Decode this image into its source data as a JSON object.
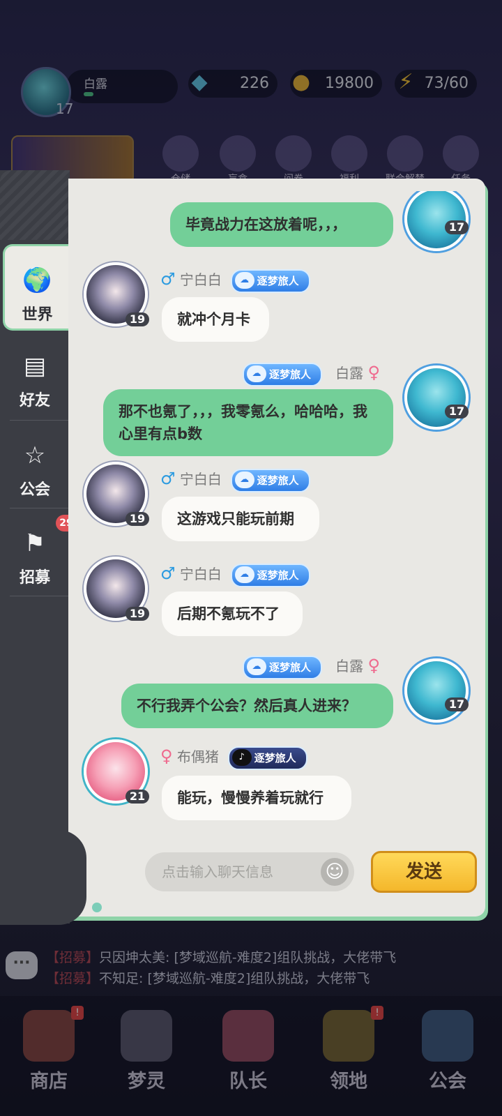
{
  "hud": {
    "player_name": "白露",
    "player_level": "17",
    "gems": "226",
    "coins": "19800",
    "energy": "73/60",
    "menu": [
      "仓储",
      "盲盒",
      "问卷",
      "福利",
      "联合解禁",
      "任务"
    ]
  },
  "tabs": [
    {
      "label": "世界",
      "icon": "globe-icon"
    },
    {
      "label": "好友",
      "icon": "notebook-icon"
    },
    {
      "label": "公会",
      "icon": "guild-shield-icon"
    },
    {
      "label": "招募",
      "icon": "flag-icon",
      "badge": "29"
    }
  ],
  "messages": [
    {
      "side": "out",
      "name": "",
      "title": "",
      "level": "17",
      "text": "毕竟战力在这放着呢，，，"
    },
    {
      "side": "in",
      "name": "宁白白",
      "gender": "♂",
      "title": "逐梦旅人",
      "level": "19",
      "text": "就冲个月卡"
    },
    {
      "side": "out",
      "name": "白露",
      "gender": "♀",
      "title": "逐梦旅人",
      "level": "17",
      "text": "那不也氪了，，，我零氪么，哈哈哈，我心里有点b数"
    },
    {
      "side": "in",
      "name": "宁白白",
      "gender": "♂",
      "title": "逐梦旅人",
      "level": "19",
      "text": "这游戏只能玩前期"
    },
    {
      "side": "in",
      "name": "宁白白",
      "gender": "♂",
      "title": "逐梦旅人",
      "level": "19",
      "text": "后期不氪玩不了"
    },
    {
      "side": "out",
      "name": "白露",
      "gender": "♀",
      "title": "逐梦旅人",
      "level": "17",
      "text": "不行我弄个公会？然后真人进来？"
    },
    {
      "side": "in",
      "name": "布偶猪",
      "gender": "♀",
      "title": "逐梦旅人",
      "level": "21",
      "text": "能玩，慢慢养着玩就行"
    }
  ],
  "input": {
    "placeholder": "点击输入聊天信息",
    "send_label": "发送"
  },
  "recruit_feed": [
    {
      "tag": "【招募】",
      "text": "只因坤太美: [梦域巡航-难度2]组队挑战，大佬带飞"
    },
    {
      "tag": "【招募】",
      "text": "不知足: [梦域巡航-难度2]组队挑战，大佬带飞"
    }
  ],
  "bottom_nav": [
    "商店",
    "梦灵",
    "队长",
    "领地",
    "公会"
  ],
  "colors": {
    "out_bubble": "#73cf98",
    "in_bubble": "#fbfaf7",
    "send_button": "#f4b72b",
    "badge_red": "#e05257"
  }
}
